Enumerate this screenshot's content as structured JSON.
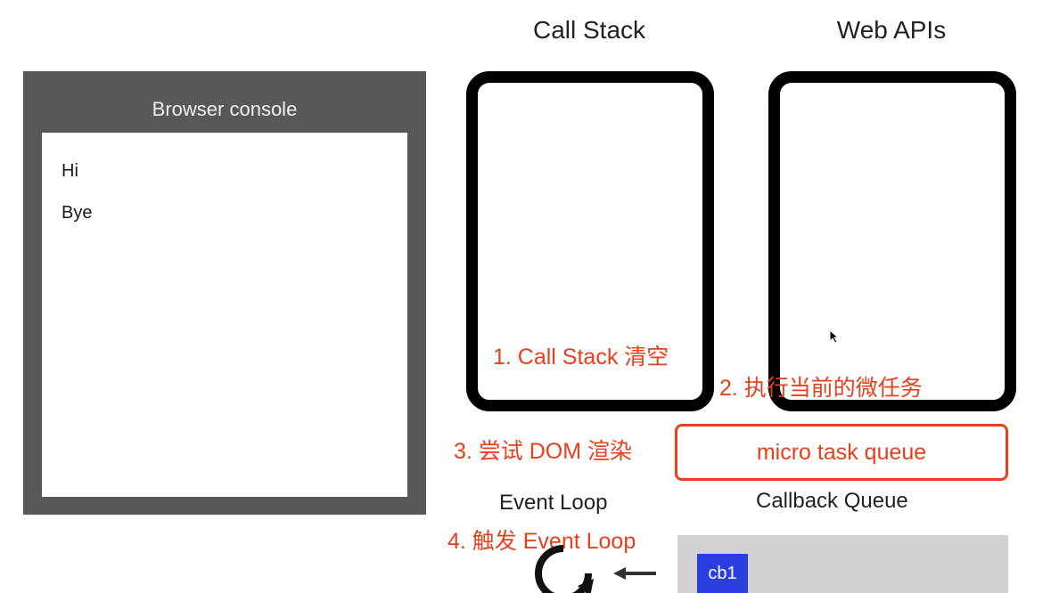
{
  "console": {
    "title": "Browser console",
    "lines": [
      "Hi",
      "Bye"
    ]
  },
  "call_stack": {
    "title": "Call Stack"
  },
  "web_apis": {
    "title": "Web APIs"
  },
  "steps": {
    "step1": "1. Call Stack 清空",
    "step2": "2. 执行当前的微任务",
    "step3": "3. 尝试 DOM 渲染",
    "step4": "4. 触发 Event Loop"
  },
  "micro_task_queue": {
    "label": "micro task queue"
  },
  "event_loop": {
    "label": "Event Loop",
    "icon": "loop-icon",
    "arrow_icon": "arrow-left-icon"
  },
  "callback_queue": {
    "label": "Callback Queue",
    "items": [
      "cb1"
    ]
  },
  "colors": {
    "annotation": "#e8401c",
    "console_frame": "#595859",
    "callback_bg": "#d2d1d3",
    "cb_chip": "#2b3fe0"
  }
}
